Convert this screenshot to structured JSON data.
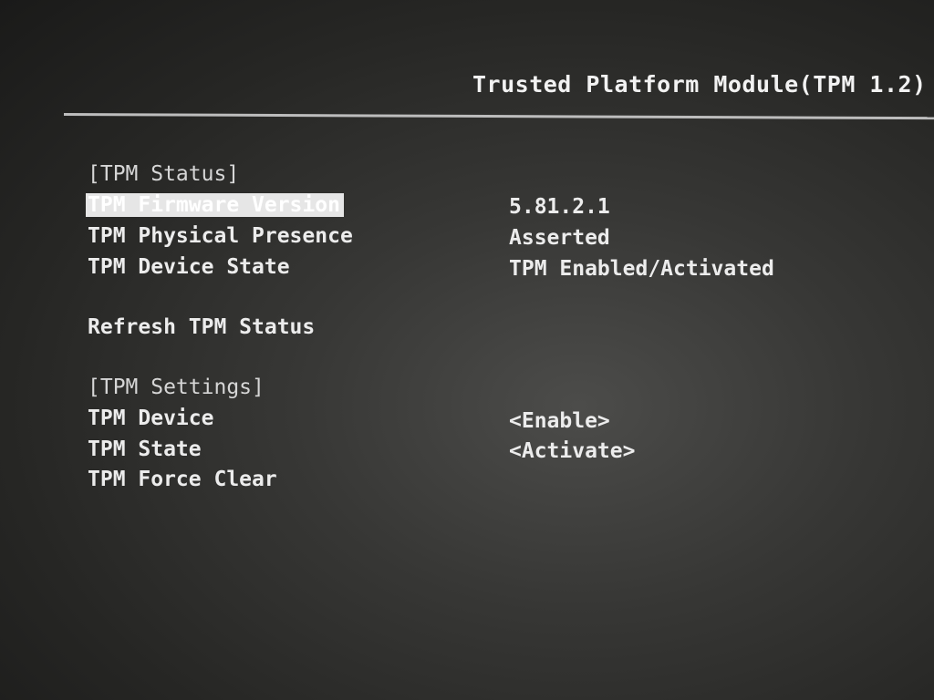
{
  "header": {
    "title": "Trusted Platform Module(TPM 1.2)"
  },
  "tpm_status": {
    "section_label": "[TPM Status]",
    "items": [
      {
        "label": "TPM Firmware Version",
        "value": "5.81.2.1"
      },
      {
        "label": "TPM Physical Presence",
        "value": "Asserted"
      },
      {
        "label": "TPM Device State",
        "value": "TPM Enabled/Activated"
      }
    ],
    "refresh_label": "Refresh TPM Status"
  },
  "tpm_settings": {
    "section_label": "[TPM Settings]",
    "items": [
      {
        "label": "TPM Device",
        "value": "<Enable>"
      },
      {
        "label": "TPM State",
        "value": "<Activate>"
      },
      {
        "label": "TPM Force Clear",
        "value": ""
      }
    ]
  },
  "colors": {
    "background": "#2e2e2c",
    "text": "#ececec",
    "highlight": "#e6e6e6"
  }
}
